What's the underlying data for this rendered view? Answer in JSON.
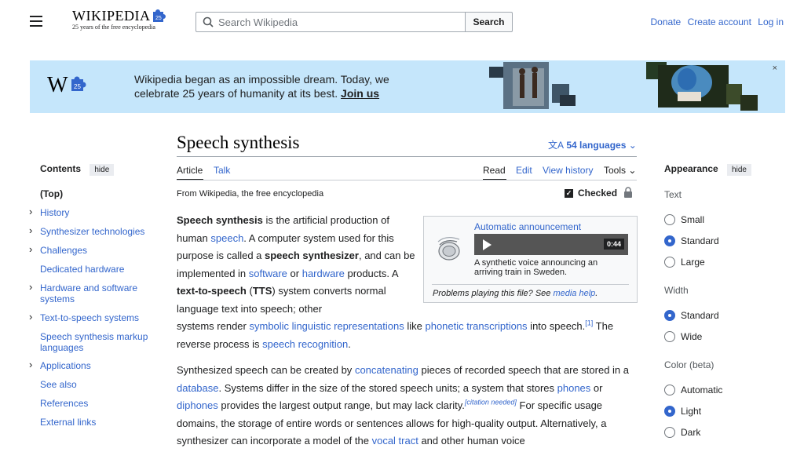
{
  "header": {
    "logo_wordmark": "WIKIPEDIA",
    "logo_tagline": "25 years of the free encyclopedia",
    "search_placeholder": "Search Wikipedia",
    "search_button": "Search",
    "donate": "Donate",
    "create_account": "Create account",
    "log_in": "Log in"
  },
  "banner": {
    "line1": "Wikipedia began as an impossible dream. Today, we",
    "line2_pre": "celebrate 25 years of humanity at its best. ",
    "join_link": "Join us",
    "close_icon": "×"
  },
  "toc": {
    "title": "Contents",
    "hide": "hide",
    "items": [
      {
        "label": "(Top)",
        "expandable": false
      },
      {
        "label": "History",
        "expandable": true
      },
      {
        "label": "Synthesizer technologies",
        "expandable": true
      },
      {
        "label": "Challenges",
        "expandable": true
      },
      {
        "label": "Dedicated hardware",
        "expandable": false
      },
      {
        "label": "Hardware and software systems",
        "expandable": true
      },
      {
        "label": "Text-to-speech systems",
        "expandable": true
      },
      {
        "label": "Speech synthesis markup languages",
        "expandable": false
      },
      {
        "label": "Applications",
        "expandable": true
      },
      {
        "label": "See also",
        "expandable": false
      },
      {
        "label": "References",
        "expandable": false
      },
      {
        "label": "External links",
        "expandable": false
      }
    ]
  },
  "article": {
    "title": "Speech synthesis",
    "languages": "54 languages",
    "tab_article": "Article",
    "tab_talk": "Talk",
    "tab_read": "Read",
    "tab_edit": "Edit",
    "tab_history": "View history",
    "tab_tools": "Tools",
    "from": "From Wikipedia, the free encyclopedia",
    "checked": "Checked"
  },
  "audio": {
    "title": "Automatic announcement",
    "duration": "0:44",
    "description": "A synthetic voice announcing an arriving train in Sweden.",
    "problems_pre": "Problems playing this file? See ",
    "problems_link": "media help",
    "problems_post": "."
  },
  "appearance": {
    "title": "Appearance",
    "hide": "hide",
    "text_label": "Text",
    "text_options": [
      "Small",
      "Standard",
      "Large"
    ],
    "text_selected": "Standard",
    "width_label": "Width",
    "width_options": [
      "Standard",
      "Wide"
    ],
    "width_selected": "Standard",
    "color_label": "Color (beta)",
    "color_options": [
      "Automatic",
      "Light",
      "Dark"
    ],
    "color_selected": "Light"
  },
  "colors": {
    "link": "#3366cc",
    "banner_bg": "#c5e6fb",
    "text": "#202122"
  }
}
